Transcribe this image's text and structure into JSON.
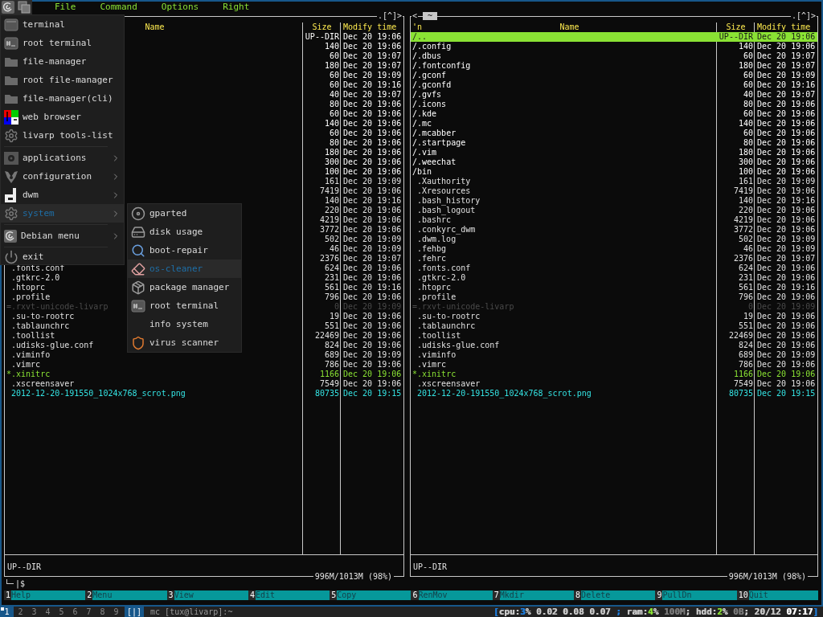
{
  "menubar": {
    "items": [
      "File",
      "Command",
      "Options",
      "Right"
    ]
  },
  "panels": [
    {
      "hotlist": ".[^]>",
      "columns": {
        "name": "Name",
        "size": "Size",
        "modified": "Modify time"
      },
      "mini_status": "UP--DIR",
      "disk": "996M/1013M (98%)",
      "rows": [
        {
          "size": "UP--DIR",
          "modified": "Dec 20 19:06",
          "kind": "dir",
          "selected": false
        },
        {
          "size": "140",
          "modified": "Dec 20 19:06",
          "kind": "dir",
          "selected": false
        },
        {
          "size": "60",
          "modified": "Dec 20 19:07",
          "kind": "dir",
          "selected": false
        },
        {
          "size": "180",
          "modified": "Dec 20 19:07",
          "kind": "dir",
          "selected": false
        },
        {
          "size": "60",
          "modified": "Dec 20 19:09",
          "kind": "dir",
          "selected": false
        },
        {
          "size": "60",
          "modified": "Dec 20 19:16",
          "kind": "dir",
          "selected": false
        },
        {
          "size": "40",
          "modified": "Dec 20 19:07",
          "kind": "dir",
          "selected": false
        },
        {
          "size": "80",
          "modified": "Dec 20 19:06",
          "kind": "dir",
          "selected": false
        },
        {
          "size": "60",
          "modified": "Dec 20 19:06",
          "kind": "dir",
          "selected": false
        },
        {
          "size": "140",
          "modified": "Dec 20 19:06",
          "kind": "dir",
          "selected": false
        },
        {
          "size": "60",
          "modified": "Dec 20 19:06",
          "kind": "dir",
          "selected": false
        },
        {
          "size": "80",
          "modified": "Dec 20 19:06",
          "kind": "dir",
          "selected": false
        },
        {
          "size": "180",
          "modified": "Dec 20 19:06",
          "kind": "dir",
          "selected": false
        },
        {
          "size": "300",
          "modified": "Dec 20 19:06",
          "kind": "dir",
          "selected": false
        },
        {
          "size": "100",
          "modified": "Dec 20 19:06",
          "kind": "dir",
          "selected": false
        },
        {
          "size": "161",
          "modified": "Dec 20 19:09",
          "kind": "file",
          "selected": false
        },
        {
          "size": "7419",
          "modified": "Dec 20 19:06",
          "kind": "file",
          "selected": false
        },
        {
          "size": "140",
          "modified": "Dec 20 19:16",
          "kind": "file",
          "selected": false
        },
        {
          "size": "220",
          "modified": "Dec 20 19:06",
          "kind": "file",
          "selected": false
        },
        {
          "size": "4219",
          "modified": "Dec 20 19:06",
          "kind": "file",
          "selected": false
        },
        {
          "size": "3772",
          "modified": "Dec 20 19:06",
          "kind": "file",
          "selected": false
        },
        {
          "size": "502",
          "modified": "Dec 20 19:09",
          "kind": "file",
          "selected": false
        },
        {
          "size": "46",
          "modified": "Dec 20 19:09",
          "kind": "file",
          "selected": false
        },
        {
          "size": "2376",
          "modified": "Dec 20 19:07",
          "kind": "file",
          "selected": false
        },
        {
          "name": ".fonts.conf",
          "size": "624",
          "modified": "Dec 20 19:06",
          "kind": "file",
          "selected": false
        },
        {
          "name": ".gtkrc-2.0",
          "size": "231",
          "modified": "Dec 20 19:06",
          "kind": "file",
          "selected": false
        },
        {
          "name": ".htoprc",
          "size": "561",
          "modified": "Dec 20 19:16",
          "kind": "file",
          "selected": false
        },
        {
          "name": ".profile",
          "size": "796",
          "modified": "Dec 20 19:06",
          "kind": "file",
          "selected": false
        },
        {
          "name": "=.rxvt-unicode-livarp",
          "size": "0",
          "modified": "Dec 20 19:09",
          "kind": "broken_link",
          "selected": false
        },
        {
          "name": ".su-to-rootrc",
          "size": "19",
          "modified": "Dec 20 19:06",
          "kind": "file",
          "selected": false
        },
        {
          "name": ".tablaunchrc",
          "size": "551",
          "modified": "Dec 20 19:06",
          "kind": "file",
          "selected": false
        },
        {
          "name": ".toollist",
          "size": "22469",
          "modified": "Dec 20 19:06",
          "kind": "file",
          "selected": false
        },
        {
          "name": ".udisks-glue.conf",
          "size": "824",
          "modified": "Dec 20 19:06",
          "kind": "file",
          "selected": false
        },
        {
          "name": ".viminfo",
          "size": "689",
          "modified": "Dec 20 19:09",
          "kind": "file",
          "selected": false
        },
        {
          "name": ".vimrc",
          "size": "786",
          "modified": "Dec 20 19:06",
          "kind": "file",
          "selected": false
        },
        {
          "name": "*.xinitrc",
          "size": "1166",
          "modified": "Dec 20 19:06",
          "kind": "exec",
          "selected": false
        },
        {
          "name": ".xscreensaver",
          "size": "7549",
          "modified": "Dec 20 19:06",
          "kind": "file",
          "selected": false
        },
        {
          "name": "2012-12-20-191550_1024x768_scrot.png",
          "size": "80735",
          "modified": "Dec 20 19:15",
          "kind": "image",
          "selected": false
        }
      ]
    },
    {
      "history_prev": "<",
      "path": "~",
      "hotlist": ".[^]>",
      "columns": {
        "sort_indicator": "'n",
        "name": "Name",
        "size": "Size",
        "modified": "Modify time"
      },
      "mini_status": "UP--DIR",
      "disk": "996M/1013M (98%)",
      "rows": [
        {
          "name": "/..",
          "size": "UP--DIR",
          "modified": "Dec 20 19:06",
          "kind": "dir",
          "selected": true
        },
        {
          "name": "/.config",
          "size": "140",
          "modified": "Dec 20 19:06",
          "kind": "dir",
          "selected": false
        },
        {
          "name": "/.dbus",
          "size": "60",
          "modified": "Dec 20 19:07",
          "kind": "dir",
          "selected": false
        },
        {
          "name": "/.fontconfig",
          "size": "180",
          "modified": "Dec 20 19:07",
          "kind": "dir",
          "selected": false
        },
        {
          "name": "/.gconf",
          "size": "60",
          "modified": "Dec 20 19:09",
          "kind": "dir",
          "selected": false
        },
        {
          "name": "/.gconfd",
          "size": "60",
          "modified": "Dec 20 19:16",
          "kind": "dir",
          "selected": false
        },
        {
          "name": "/.gvfs",
          "size": "40",
          "modified": "Dec 20 19:07",
          "kind": "dir",
          "selected": false
        },
        {
          "name": "/.icons",
          "size": "80",
          "modified": "Dec 20 19:06",
          "kind": "dir",
          "selected": false
        },
        {
          "name": "/.kde",
          "size": "60",
          "modified": "Dec 20 19:06",
          "kind": "dir",
          "selected": false
        },
        {
          "name": "/.mc",
          "size": "140",
          "modified": "Dec 20 19:06",
          "kind": "dir",
          "selected": false
        },
        {
          "name": "/.mcabber",
          "size": "60",
          "modified": "Dec 20 19:06",
          "kind": "dir",
          "selected": false
        },
        {
          "name": "/.startpage",
          "size": "80",
          "modified": "Dec 20 19:06",
          "kind": "dir",
          "selected": false
        },
        {
          "name": "/.vim",
          "size": "180",
          "modified": "Dec 20 19:06",
          "kind": "dir",
          "selected": false
        },
        {
          "name": "/.weechat",
          "size": "300",
          "modified": "Dec 20 19:06",
          "kind": "dir",
          "selected": false
        },
        {
          "name": "/bin",
          "size": "100",
          "modified": "Dec 20 19:06",
          "kind": "dir",
          "selected": false
        },
        {
          "name": ".Xauthority",
          "size": "161",
          "modified": "Dec 20 19:09",
          "kind": "file",
          "selected": false
        },
        {
          "name": ".Xresources",
          "size": "7419",
          "modified": "Dec 20 19:06",
          "kind": "file",
          "selected": false
        },
        {
          "name": ".bash_history",
          "size": "140",
          "modified": "Dec 20 19:16",
          "kind": "file",
          "selected": false
        },
        {
          "name": ".bash_logout",
          "size": "220",
          "modified": "Dec 20 19:06",
          "kind": "file",
          "selected": false
        },
        {
          "name": ".bashrc",
          "size": "4219",
          "modified": "Dec 20 19:06",
          "kind": "file",
          "selected": false
        },
        {
          "name": ".conkyrc_dwm",
          "size": "3772",
          "modified": "Dec 20 19:06",
          "kind": "file",
          "selected": false
        },
        {
          "name": ".dwm.log",
          "size": "502",
          "modified": "Dec 20 19:09",
          "kind": "file",
          "selected": false
        },
        {
          "name": ".fehbg",
          "size": "46",
          "modified": "Dec 20 19:09",
          "kind": "file",
          "selected": false
        },
        {
          "name": ".fehrc",
          "size": "2376",
          "modified": "Dec 20 19:07",
          "kind": "file",
          "selected": false
        },
        {
          "name": ".fonts.conf",
          "size": "624",
          "modified": "Dec 20 19:06",
          "kind": "file",
          "selected": false
        },
        {
          "name": ".gtkrc-2.0",
          "size": "231",
          "modified": "Dec 20 19:06",
          "kind": "file",
          "selected": false
        },
        {
          "name": ".htoprc",
          "size": "561",
          "modified": "Dec 20 19:16",
          "kind": "file",
          "selected": false
        },
        {
          "name": ".profile",
          "size": "796",
          "modified": "Dec 20 19:06",
          "kind": "file",
          "selected": false
        },
        {
          "name": "=.rxvt-unicode-livarp",
          "size": "0",
          "modified": "Dec 20 19:09",
          "kind": "broken_link",
          "selected": false
        },
        {
          "name": ".su-to-rootrc",
          "size": "19",
          "modified": "Dec 20 19:06",
          "kind": "file",
          "selected": false
        },
        {
          "name": ".tablaunchrc",
          "size": "551",
          "modified": "Dec 20 19:06",
          "kind": "file",
          "selected": false
        },
        {
          "name": ".toollist",
          "size": "22469",
          "modified": "Dec 20 19:06",
          "kind": "file",
          "selected": false
        },
        {
          "name": ".udisks-glue.conf",
          "size": "824",
          "modified": "Dec 20 19:06",
          "kind": "file",
          "selected": false
        },
        {
          "name": ".viminfo",
          "size": "689",
          "modified": "Dec 20 19:09",
          "kind": "file",
          "selected": false
        },
        {
          "name": ".vimrc",
          "size": "786",
          "modified": "Dec 20 19:06",
          "kind": "file",
          "selected": false
        },
        {
          "name": "*.xinitrc",
          "size": "1166",
          "modified": "Dec 20 19:06",
          "kind": "exec",
          "selected": false
        },
        {
          "name": ".xscreensaver",
          "size": "7549",
          "modified": "Dec 20 19:06",
          "kind": "file",
          "selected": false
        },
        {
          "name": "2012-12-20-191550_1024x768_scrot.png",
          "size": "80735",
          "modified": "Dec 20 19:15",
          "kind": "image",
          "selected": false
        }
      ]
    }
  ],
  "prompt": "|$",
  "function_keys": [
    {
      "number": "1",
      "label": "Help"
    },
    {
      "number": "2",
      "label": "Menu"
    },
    {
      "number": "3",
      "label": "View"
    },
    {
      "number": "4",
      "label": "Edit"
    },
    {
      "number": "5",
      "label": "Copy"
    },
    {
      "number": "6",
      "label": "RenMov"
    },
    {
      "number": "7",
      "label": "Mkdir"
    },
    {
      "number": "8",
      "label": "Delete"
    },
    {
      "number": "9",
      "label": "PullDn"
    },
    {
      "number": "10",
      "label": "Quit"
    }
  ],
  "launcher": {
    "groups": [
      [
        {
          "label": "terminal",
          "has_submenu": false,
          "selected": false
        },
        {
          "label": "root terminal",
          "has_submenu": false,
          "selected": false
        },
        {
          "label": "file-manager",
          "has_submenu": false,
          "selected": false
        },
        {
          "label": "root file-manager",
          "has_submenu": false,
          "selected": false
        },
        {
          "label": "file-manager(cli)",
          "has_submenu": false,
          "selected": false
        },
        {
          "label": "web browser",
          "has_submenu": false,
          "selected": false
        },
        {
          "label": "livarp tools-list",
          "has_submenu": false,
          "selected": false
        }
      ],
      [
        {
          "label": "applications",
          "has_submenu": true,
          "selected": false
        },
        {
          "label": "configuration",
          "has_submenu": true,
          "selected": false
        },
        {
          "label": "dwm",
          "has_submenu": true,
          "selected": false
        },
        {
          "label": "system",
          "has_submenu": true,
          "selected": true
        }
      ],
      [
        {
          "label": "Debian menu",
          "has_submenu": true,
          "selected": false
        }
      ],
      [
        {
          "label": "exit",
          "has_submenu": false,
          "selected": false
        }
      ]
    ],
    "submenu": [
      {
        "label": "gparted",
        "selected": false
      },
      {
        "label": "disk usage",
        "selected": false
      },
      {
        "label": "boot-repair",
        "selected": false
      },
      {
        "label": "os-cleaner",
        "selected": true
      },
      {
        "label": "package manager",
        "selected": false
      },
      {
        "label": "root terminal",
        "selected": false
      },
      {
        "label": "info system",
        "selected": false
      },
      {
        "label": "virus scanner",
        "selected": false
      }
    ]
  },
  "dwm_bar": {
    "tags": [
      {
        "label": "1",
        "selected": true,
        "occupied": true
      },
      {
        "label": "2",
        "selected": false,
        "occupied": false
      },
      {
        "label": "3",
        "selected": false,
        "occupied": false
      },
      {
        "label": "4",
        "selected": false,
        "occupied": false
      },
      {
        "label": "5",
        "selected": false,
        "occupied": false
      },
      {
        "label": "6",
        "selected": false,
        "occupied": false
      },
      {
        "label": "7",
        "selected": false,
        "occupied": false
      },
      {
        "label": "8",
        "selected": false,
        "occupied": false
      },
      {
        "label": "9",
        "selected": false,
        "occupied": false
      }
    ],
    "layout": "[|]",
    "title": "mc [tux@livarp]:~",
    "status": [
      {
        "text": "[",
        "color": "#1e7fe0"
      },
      {
        "text": "cpu:",
        "color": "#c8c8c8"
      },
      {
        "text": "3",
        "color": "#1e7fe0"
      },
      {
        "text": "% 0.02 0.08 0.07 ",
        "color": "#c8c8c8"
      },
      {
        "text": ";",
        "color": "#1e7fe0"
      },
      {
        "text": " ram:",
        "color": "#c8c8c8"
      },
      {
        "text": "4",
        "color": "#8ae234"
      },
      {
        "text": "% ",
        "color": "#c8c8c8"
      },
      {
        "text": "100M",
        "color": "#7a7a7a"
      },
      {
        "text": "; hdd:",
        "color": "#c8c8c8"
      },
      {
        "text": "2",
        "color": "#8ae234"
      },
      {
        "text": "% ",
        "color": "#c8c8c8"
      },
      {
        "text": "0B",
        "color": "#7a7a7a"
      },
      {
        "text": "; 20/12 ",
        "color": "#c8c8c8"
      },
      {
        "text": "07:17",
        "color": "#ffffff"
      },
      {
        "text": "]",
        "color": "#1e7fe0"
      }
    ]
  }
}
